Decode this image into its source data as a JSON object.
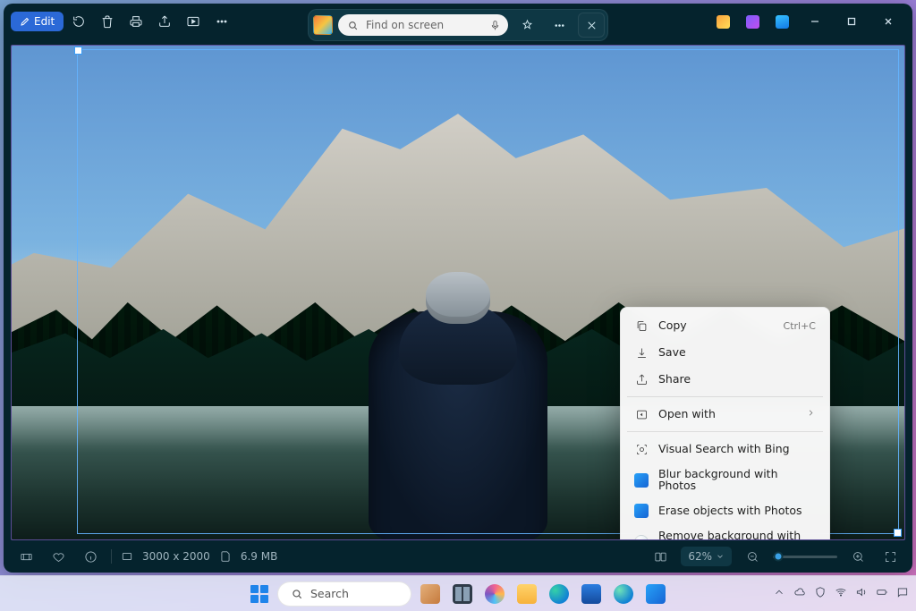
{
  "toolbar": {
    "edit_label": "Edit"
  },
  "captionbar": {
    "search_placeholder": "Find on screen"
  },
  "context_menu": {
    "copy": "Copy",
    "copy_shortcut": "Ctrl+C",
    "save": "Save",
    "share": "Share",
    "open_with": "Open with",
    "visual_search": "Visual Search with Bing",
    "blur_bg": "Blur background with Photos",
    "erase_objects": "Erase objects with Photos",
    "remove_bg": "Remove background with Paint"
  },
  "statusbar": {
    "dimensions": "3000 x 2000",
    "filesize": "6.9 MB",
    "zoom": "62%"
  },
  "taskbar": {
    "search_placeholder": "Search"
  }
}
